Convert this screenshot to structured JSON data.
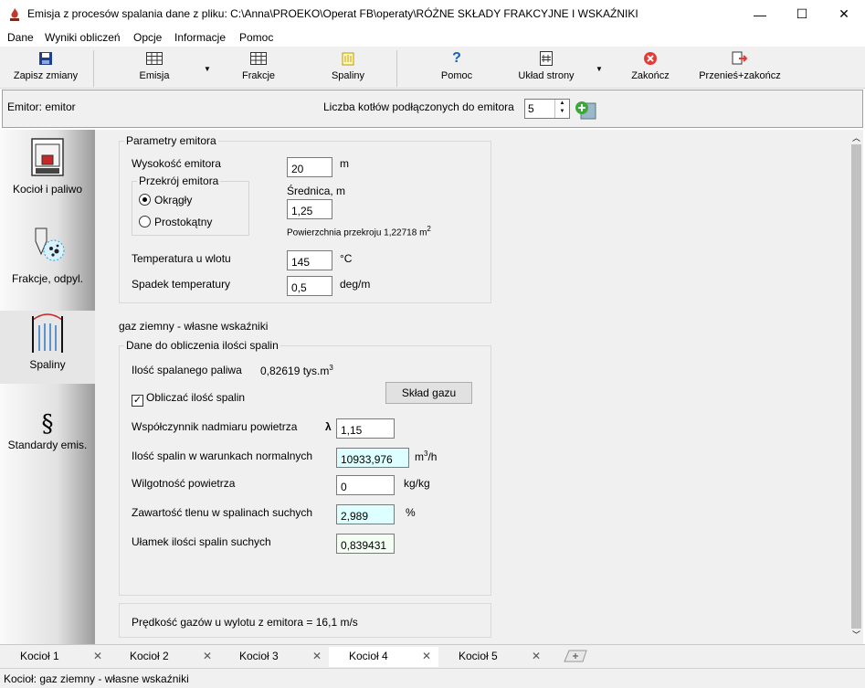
{
  "window": {
    "title": "Emisja z procesów spalania   dane z pliku: C:\\Anna\\PROEKO\\Operat FB\\operaty\\RÓŻNE SKŁADY FRAKCYJNE I WSKAŹNIKI",
    "minimize_glyph": "—",
    "maximize_glyph": "☐",
    "close_glyph": "✕"
  },
  "menu": [
    "Dane",
    "Wyniki obliczeń",
    "Opcje",
    "Informacje",
    "Pomoc"
  ],
  "toolbar": {
    "save": "Zapisz zmiany",
    "emisja": "Emisja",
    "frakcje": "Frakcje",
    "spaliny": "Spaliny",
    "pomoc": "Pomoc",
    "uklad": "Układ strony",
    "zakoncz": "Zakończ",
    "przenies": "Przenieś+zakończ",
    "dropdown_glyph": "▼"
  },
  "emitor_bar": {
    "emitor_label": "Emitor: emitor",
    "boilers_label": "Liczba kotłów podłączonych do emitora",
    "boilers_value": "5",
    "spin_up": "▲",
    "spin_down": "▼"
  },
  "nav": {
    "items": [
      {
        "label": "Kocioł i paliwo"
      },
      {
        "label": "Frakcje, odpyl."
      },
      {
        "label": "Spaliny"
      },
      {
        "label": "Standardy emis."
      }
    ],
    "paragraph_glyph": "§"
  },
  "params": {
    "legend": "Parametry emitora",
    "height_label": "Wysokość emitora",
    "height_value": "20",
    "height_unit": "m",
    "cross_legend": "Przekrój emitora",
    "round_label": "Okrągły",
    "rect_label": "Prostokątny",
    "diameter_label": "Średnica, m",
    "diameter_value": "1,25",
    "area_text": "Powierzchnia przekroju 1,22718 m",
    "area_sup": "2",
    "temp_label": "Temperatura u wlotu",
    "temp_value": "145",
    "temp_unit": "°C",
    "drop_label": "Spadek temperatury",
    "drop_value": "0,5",
    "drop_unit": "deg/m"
  },
  "fuel_title": "gaz ziemny - własne wskaźniki",
  "exhaust": {
    "legend": "Dane do obliczenia ilości spalin",
    "fuel_amount_label": "Ilość spalanego paliwa",
    "fuel_amount_value": "0,82619 tys.m",
    "fuel_amount_sup": "3",
    "compute_label": "Obliczać ilość spalin",
    "compute_checked": "✓",
    "gas_button": "Skład gazu",
    "excess_label": "Współczynnik nadmiaru powietrza",
    "lambda": "λ",
    "excess_value": "1,15",
    "normal_label": "Ilość spalin w warunkach normalnych",
    "normal_value": "10933,976",
    "normal_unit": "m",
    "normal_unit_sup": "3",
    "normal_unit_tail": "/h",
    "humidity_label": "Wilgotność powietrza",
    "humidity_value": "0",
    "humidity_unit": "kg/kg",
    "oxygen_label": "Zawartość tlenu w spalinach suchych",
    "oxygen_value": "2,989",
    "oxygen_unit": "%",
    "fraction_label": "Ułamek ilości spalin suchych",
    "fraction_value": "0,839431"
  },
  "velocity_text": "Prędkość gazów u wylotu z emitora = 16,1 m/s",
  "tabs": [
    {
      "label": "Kocioł 1"
    },
    {
      "label": "Kocioł 2"
    },
    {
      "label": "Kocioł 3"
    },
    {
      "label": "Kocioł 4"
    },
    {
      "label": "Kocioł 5"
    }
  ],
  "tab_close_glyph": "✕",
  "status": "Kocioł: gaz ziemny - własne wskaźniki",
  "colors": {
    "readonly_field": "#ddffff",
    "content_bg": "#f0f0f0"
  }
}
